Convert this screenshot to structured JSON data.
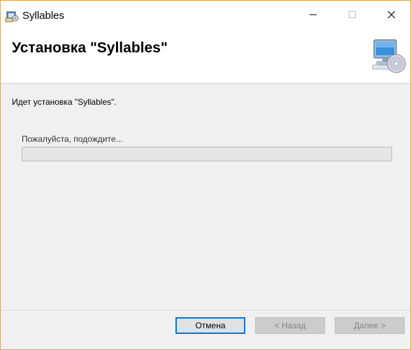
{
  "window": {
    "title": "Syllables",
    "border_color": "#e0a53a"
  },
  "banner": {
    "title": "Установка \"Syllables\""
  },
  "body": {
    "status": "Идет установка \"Syllables\".",
    "wait_label": "Пожалуйста, подождите...",
    "progress": 0
  },
  "buttons": {
    "cancel": "Отмена",
    "back": "< Назад",
    "next": "Далее >"
  },
  "icons": {
    "app": "installer-icon",
    "setup": "computer-cd-icon",
    "minimize": "minimize-icon",
    "maximize": "maximize-icon",
    "close": "close-icon"
  }
}
